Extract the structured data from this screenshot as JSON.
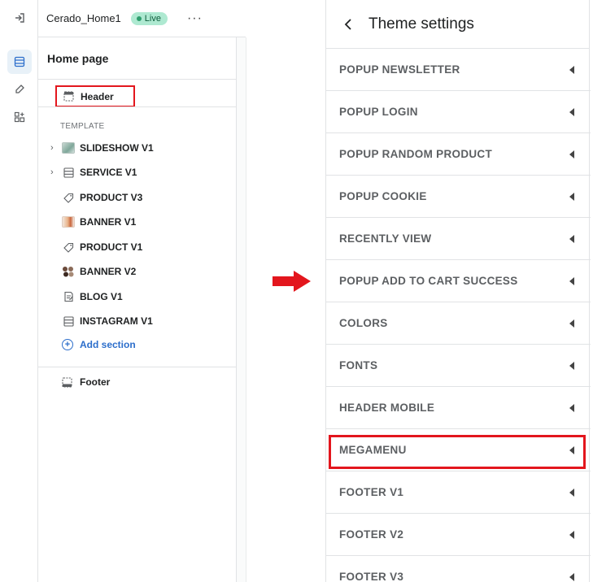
{
  "topbar": {
    "store_name": "Cerado_Home1",
    "status_badge": "Live",
    "more_label": "···"
  },
  "sidebar_rail": {
    "icons": [
      "exit-icon",
      "sections-icon",
      "theme-brush-icon",
      "apps-icon"
    ],
    "active_index": 1
  },
  "page_panel": {
    "title": "Home page",
    "header_label": "Header",
    "template_label": "TEMPLATE",
    "sections": [
      {
        "label": "SLIDESHOW V1",
        "icon": "image-thumbnail-icon",
        "expandable": true
      },
      {
        "label": "SERVICE V1",
        "icon": "section-icon",
        "expandable": true
      },
      {
        "label": "PRODUCT V3",
        "icon": "tag-icon",
        "expandable": false
      },
      {
        "label": "BANNER V1",
        "icon": "image-thumbnail-icon",
        "expandable": false
      },
      {
        "label": "PRODUCT V1",
        "icon": "tag-icon",
        "expandable": false
      },
      {
        "label": "BANNER V2",
        "icon": "image-thumbnail-icon",
        "expandable": false
      },
      {
        "label": "BLOG V1",
        "icon": "blog-icon",
        "expandable": false
      },
      {
        "label": "INSTAGRAM V1",
        "icon": "section-icon",
        "expandable": false
      }
    ],
    "add_section_label": "Add section",
    "footer_label": "Footer"
  },
  "theme_settings": {
    "title": "Theme settings",
    "items": [
      "POPUP NEWSLETTER",
      "POPUP LOGIN",
      "POPUP RANDOM PRODUCT",
      "POPUP COOKIE",
      "RECENTLY VIEW",
      "POPUP ADD TO CART SUCCESS",
      "COLORS",
      "FONTS",
      "HEADER MOBILE",
      "MEGAMENU",
      "FOOTER V1",
      "FOOTER V2",
      "FOOTER V3"
    ],
    "highlighted_item": "MEGAMENU"
  },
  "colors": {
    "highlight": "#e3161d",
    "accent": "#2c6ecb",
    "live_badge": "#aee9d1"
  }
}
